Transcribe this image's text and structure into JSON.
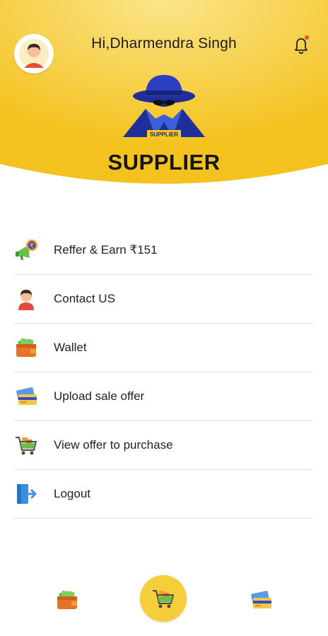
{
  "header": {
    "greeting": "Hi,Dharmendra Singh",
    "brand_title": "SUPPLIER",
    "logo_caption": "SUPPLIER",
    "bg_colors": [
      "#f5c824",
      "#fbe58a"
    ],
    "notification_dot_color": "#e84a3c"
  },
  "menu": {
    "items": [
      {
        "label": "Reffer & Earn ₹151",
        "icon": "megaphone-rupee-icon"
      },
      {
        "label": "Contact US",
        "icon": "contact-person-icon"
      },
      {
        "label": "Wallet",
        "icon": "wallet-icon"
      },
      {
        "label": "Upload sale offer",
        "icon": "card-upload-icon"
      },
      {
        "label": "View offer to purchase",
        "icon": "shopping-cart-icon"
      },
      {
        "label": "Logout",
        "icon": "logout-icon"
      }
    ]
  },
  "bottom_nav": {
    "items": [
      "wallet-icon",
      "shopping-cart-icon",
      "card-upload-icon"
    ],
    "active": "shopping-cart-icon",
    "active_color": "#f6cd3a"
  }
}
